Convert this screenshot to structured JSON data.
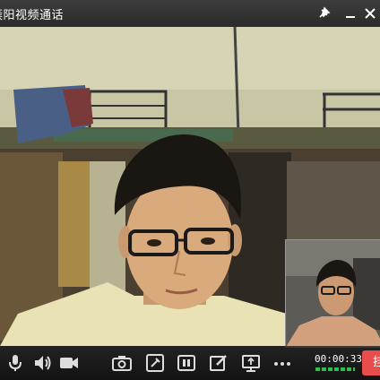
{
  "window": {
    "title": "簇阳视频通话",
    "pin_icon": "pin-icon",
    "minimize_icon": "minimize-icon",
    "close_icon": "close-icon"
  },
  "call": {
    "timer": "00:00:33",
    "hangup_label": "挂"
  },
  "toolbar": {
    "icons": [
      "microphone-icon",
      "speaker-icon",
      "camera-icon",
      "snapshot-icon",
      "magic-effects-icon",
      "pause-icon",
      "whiteboard-icon",
      "screen-share-icon",
      "more-icon"
    ]
  },
  "colors": {
    "titlebar": "#333333",
    "hangup": "#e84c4c",
    "signal": "#2ec04a"
  }
}
